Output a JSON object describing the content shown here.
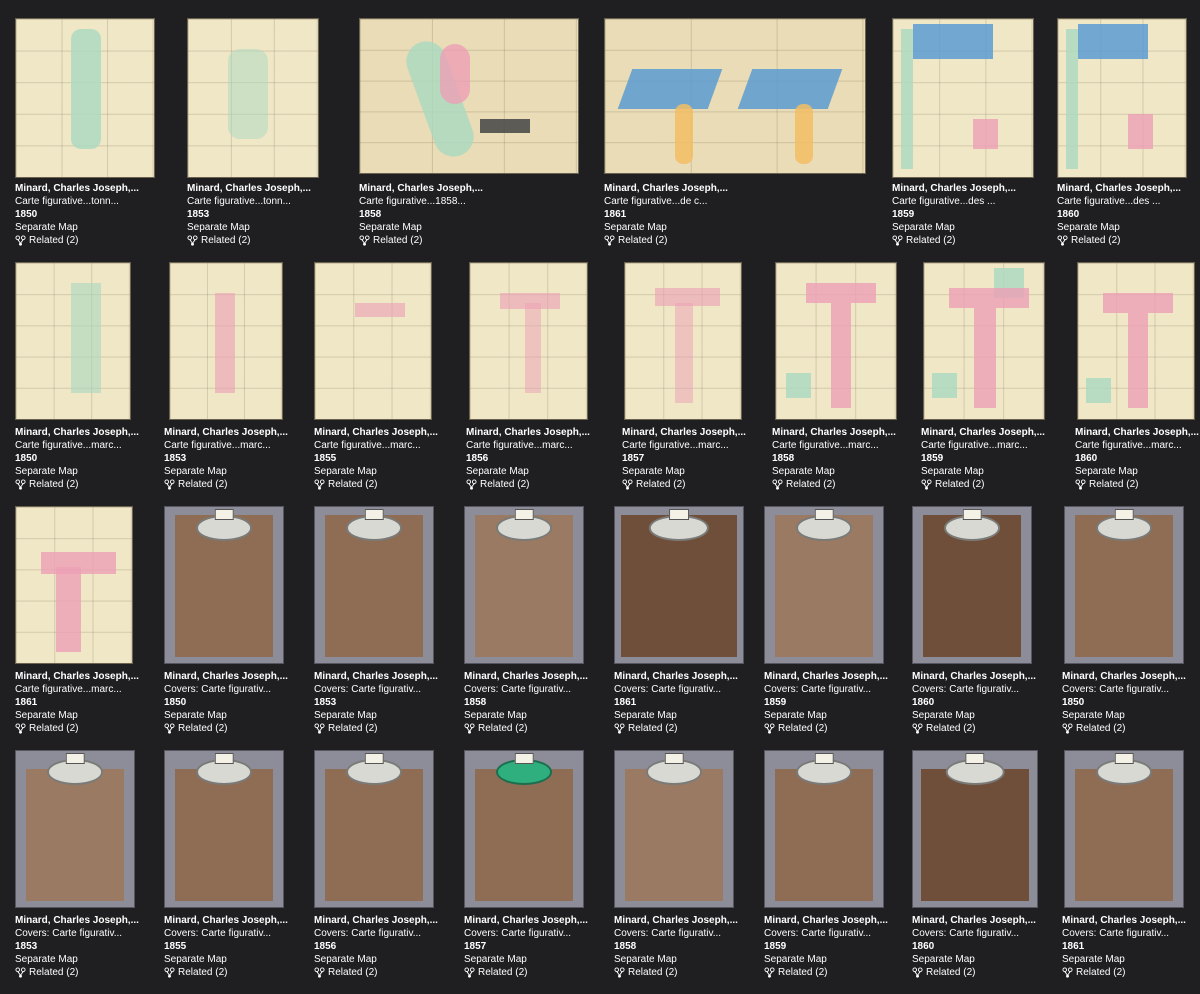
{
  "rows": [
    {
      "items": [
        {
          "author": "Minard, Charles Joseph,...",
          "title": "Carte figurative...tonn...",
          "year": "1850",
          "type": "Separate Map",
          "related": "Related (2)"
        },
        {
          "author": "Minard, Charles Joseph,...",
          "title": "Carte figurative...tonn...",
          "year": "1853",
          "type": "Separate Map",
          "related": "Related (2)"
        },
        {
          "author": "Minard, Charles Joseph,...",
          "title": "Carte figurative...1858...",
          "year": "1858",
          "type": "Separate Map",
          "related": "Related (2)"
        },
        {
          "author": "Minard, Charles Joseph,...",
          "title": "Carte figurative...de c...",
          "year": "1861",
          "type": "Separate Map",
          "related": "Related (2)"
        },
        {
          "author": "Minard, Charles Joseph,...",
          "title": "Carte figurative...des ...",
          "year": "1859",
          "type": "Separate Map",
          "related": "Related (2)"
        },
        {
          "author": "Minard, Charles Joseph,...",
          "title": "Carte figurative...des ...",
          "year": "1860",
          "type": "Separate Map",
          "related": "Related (2)"
        }
      ]
    },
    {
      "items": [
        {
          "author": "Minard, Charles Joseph,...",
          "title": "Carte figurative...marc...",
          "year": "1850",
          "type": "Separate Map",
          "related": "Related (2)"
        },
        {
          "author": "Minard, Charles Joseph,...",
          "title": "Carte figurative...marc...",
          "year": "1853",
          "type": "Separate Map",
          "related": "Related (2)"
        },
        {
          "author": "Minard, Charles Joseph,...",
          "title": "Carte figurative...marc...",
          "year": "1855",
          "type": "Separate Map",
          "related": "Related (2)"
        },
        {
          "author": "Minard, Charles Joseph,...",
          "title": "Carte figurative...marc...",
          "year": "1856",
          "type": "Separate Map",
          "related": "Related (2)"
        },
        {
          "author": "Minard, Charles Joseph,...",
          "title": "Carte figurative...marc...",
          "year": "1857",
          "type": "Separate Map",
          "related": "Related (2)"
        },
        {
          "author": "Minard, Charles Joseph,...",
          "title": "Carte figurative...marc...",
          "year": "1858",
          "type": "Separate Map",
          "related": "Related (2)"
        },
        {
          "author": "Minard, Charles Joseph,...",
          "title": "Carte figurative...marc...",
          "year": "1859",
          "type": "Separate Map",
          "related": "Related (2)"
        },
        {
          "author": "Minard, Charles Joseph,...",
          "title": "Carte figurative...marc...",
          "year": "1860",
          "type": "Separate Map",
          "related": "Related (2)"
        }
      ]
    },
    {
      "items": [
        {
          "author": "Minard, Charles Joseph,...",
          "title": "Carte figurative...marc...",
          "year": "1861",
          "type": "Separate Map",
          "related": "Related (2)"
        },
        {
          "author": "Minard, Charles Joseph,...",
          "title": "Covers: Carte figurativ...",
          "year": "1850",
          "type": "Separate Map",
          "related": "Related (2)"
        },
        {
          "author": "Minard, Charles Joseph,...",
          "title": "Covers: Carte figurativ...",
          "year": "1853",
          "type": "Separate Map",
          "related": "Related (2)"
        },
        {
          "author": "Minard, Charles Joseph,...",
          "title": "Covers: Carte figurativ...",
          "year": "1858",
          "type": "Separate Map",
          "related": "Related (2)"
        },
        {
          "author": "Minard, Charles Joseph,...",
          "title": "Covers: Carte figurativ...",
          "year": "1861",
          "type": "Separate Map",
          "related": "Related (2)"
        },
        {
          "author": "Minard, Charles Joseph,...",
          "title": "Covers: Carte figurativ...",
          "year": "1859",
          "type": "Separate Map",
          "related": "Related (2)"
        },
        {
          "author": "Minard, Charles Joseph,...",
          "title": "Covers: Carte figurativ...",
          "year": "1860",
          "type": "Separate Map",
          "related": "Related (2)"
        },
        {
          "author": "Minard, Charles Joseph,...",
          "title": "Covers: Carte figurativ...",
          "year": "1850",
          "type": "Separate Map",
          "related": "Related (2)"
        }
      ]
    },
    {
      "items": [
        {
          "author": "Minard, Charles Joseph,...",
          "title": "Covers: Carte figurativ...",
          "year": "1853",
          "type": "Separate Map",
          "related": "Related (2)"
        },
        {
          "author": "Minard, Charles Joseph,...",
          "title": "Covers: Carte figurativ...",
          "year": "1855",
          "type": "Separate Map",
          "related": "Related (2)"
        },
        {
          "author": "Minard, Charles Joseph,...",
          "title": "Covers: Carte figurativ...",
          "year": "1856",
          "type": "Separate Map",
          "related": "Related (2)"
        },
        {
          "author": "Minard, Charles Joseph,...",
          "title": "Covers: Carte figurativ...",
          "year": "1857",
          "type": "Separate Map",
          "related": "Related (2)"
        },
        {
          "author": "Minard, Charles Joseph,...",
          "title": "Covers: Carte figurativ...",
          "year": "1858",
          "type": "Separate Map",
          "related": "Related (2)"
        },
        {
          "author": "Minard, Charles Joseph,...",
          "title": "Covers: Carte figurativ...",
          "year": "1859",
          "type": "Separate Map",
          "related": "Related (2)"
        },
        {
          "author": "Minard, Charles Joseph,...",
          "title": "Covers: Carte figurativ...",
          "year": "1860",
          "type": "Separate Map",
          "related": "Related (2)"
        },
        {
          "author": "Minard, Charles Joseph,...",
          "title": "Covers: Carte figurativ...",
          "year": "1861",
          "type": "Separate Map",
          "related": "Related (2)"
        }
      ]
    }
  ],
  "colors": {
    "background": "#1f1e20",
    "text": "#ffffff"
  },
  "icons": {
    "related": "related-network-icon"
  }
}
